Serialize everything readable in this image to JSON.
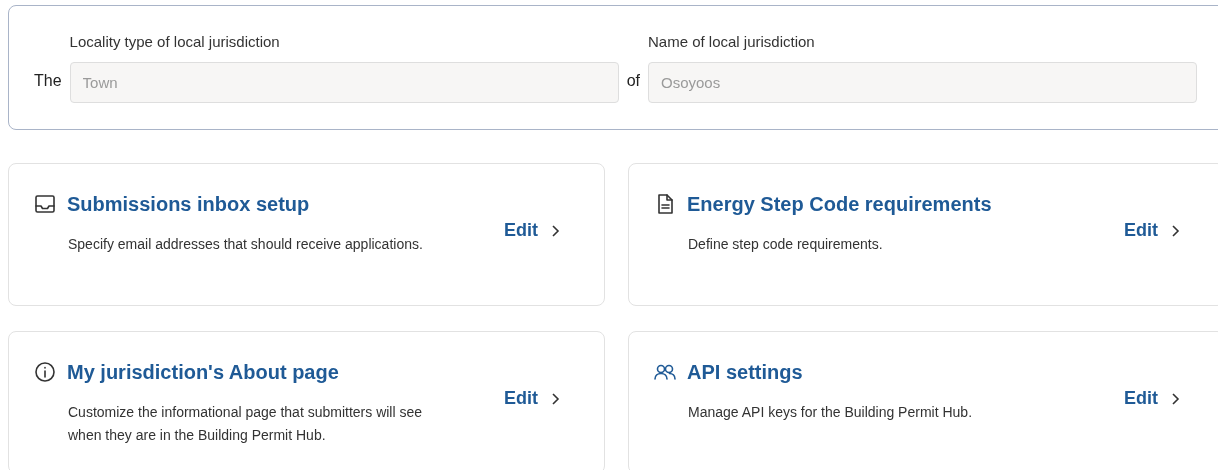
{
  "jurisdiction": {
    "prefix": "The",
    "locality_type": {
      "label": "Locality type of local jurisdiction",
      "value": "Town",
      "disabled": true
    },
    "joiner": "of",
    "name": {
      "label": "Name of local jurisdiction",
      "value": "Osoyoos",
      "disabled": true
    }
  },
  "cards": [
    {
      "kind": "inbox",
      "title": "Submissions inbox setup",
      "description": "Specify email addresses that should receive applications.",
      "action": "Edit"
    },
    {
      "kind": "document",
      "title": "Energy Step Code requirements",
      "description": "Define step code requirements.",
      "action": "Edit"
    },
    {
      "kind": "info",
      "title": "My jurisdiction's About page",
      "description": "Customize the informational page that submitters will see when they are in the Building Permit Hub.",
      "action": "Edit"
    },
    {
      "kind": "users",
      "title": "API settings",
      "description": "Manage API keys for the Building Permit Hub.",
      "action": "Edit"
    }
  ]
}
